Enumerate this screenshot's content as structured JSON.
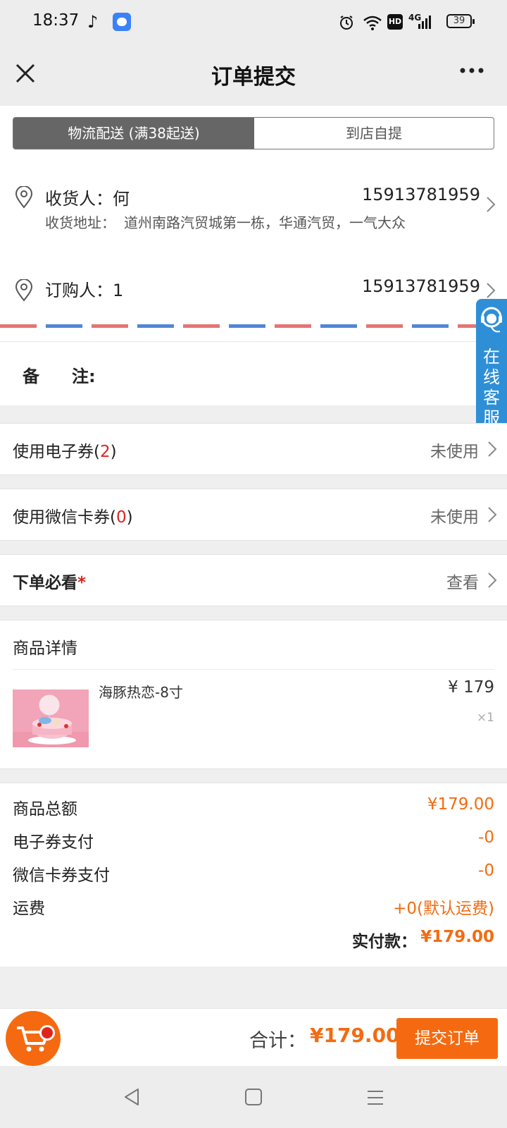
{
  "status_bar": {
    "time": "18:37",
    "network": "4G",
    "hd": "HD",
    "battery": "39",
    "icons": [
      "tiktok-icon",
      "app-icon",
      "alarm-icon",
      "wifi-icon",
      "hd-icon",
      "signal-icon",
      "battery-icon"
    ]
  },
  "nav": {
    "title": "订单提交",
    "close_icon": "close-icon",
    "more_icon": "more-icon"
  },
  "delivery_tabs": {
    "active": "物流配送 (满38起送)",
    "inactive": "到店自提"
  },
  "receiver": {
    "label": "收货人：何",
    "phone": "15913781959",
    "address_label": "收货地址：",
    "address": "道州南路汽贸城第一栋，华通汽贸，一气大众"
  },
  "orderer": {
    "label": "订购人：1",
    "phone": "15913781959"
  },
  "note": {
    "label_1": "备",
    "label_2": "注:"
  },
  "customer_service": {
    "label": "在线客服"
  },
  "coupons": {
    "e_coupon_label": "使用电子券(",
    "e_coupon_count": "2",
    "e_coupon_close": ")",
    "e_coupon_status": "未使用",
    "wx_coupon_label": "使用微信卡券(",
    "wx_coupon_count": "0",
    "wx_coupon_close": ")",
    "wx_coupon_status": "未使用"
  },
  "must_read": {
    "label": "下单必看",
    "required_mark": "*",
    "action": "查看"
  },
  "product": {
    "section_title": "商品详情",
    "name": "海豚热恋-8寸",
    "price": "¥ 179",
    "qty": "×1"
  },
  "summary": {
    "goods_total_label": "商品总额",
    "goods_total": "¥179.00",
    "e_coupon_pay_label": "电子券支付",
    "e_coupon_pay": "-0",
    "wx_coupon_pay_label": "微信卡券支付",
    "wx_coupon_pay": "-0",
    "shipping_label": "运费",
    "shipping": "+0(默认运费)",
    "paid_label": "实付款：",
    "paid": "¥179.00"
  },
  "bottom": {
    "total_label": "合计：",
    "total": "¥179.00",
    "submit": "提交订单"
  },
  "colors": {
    "accent": "#f56a10",
    "price": "#f36b12",
    "red": "#e0241c",
    "segment_active": "#666666",
    "service_blue": "#2e8fd6"
  }
}
